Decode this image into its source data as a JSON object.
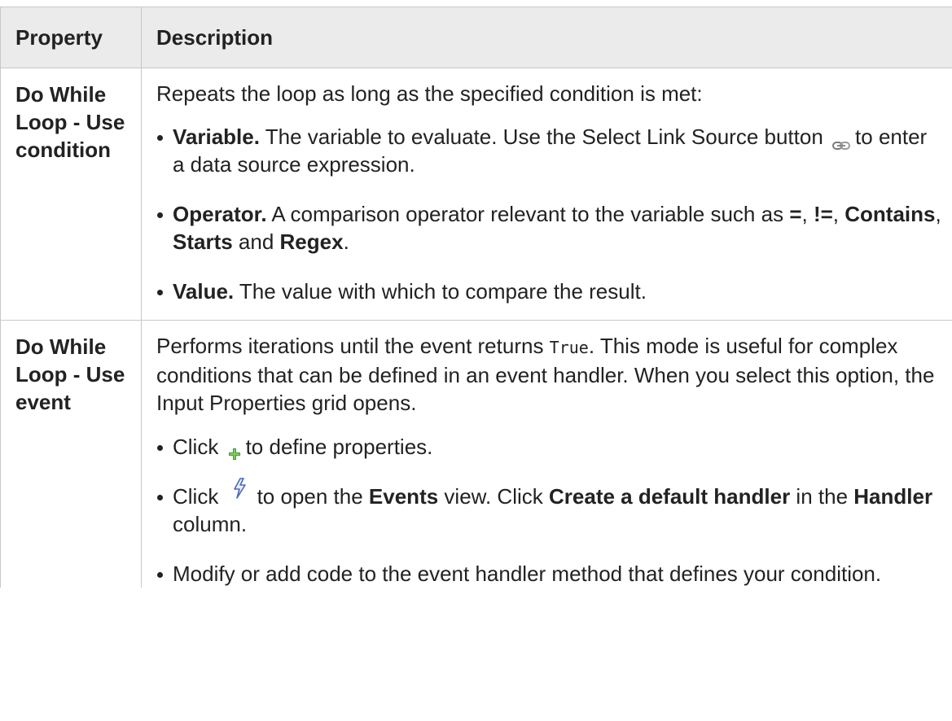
{
  "table": {
    "headers": {
      "property": "Property",
      "description": "Description"
    },
    "row1": {
      "property": "Do While Loop - Use condition",
      "intro": "Repeats the loop as long as the specified condition is met:",
      "variable": {
        "term": "Variable.",
        "text_before_icon": " The variable to evaluate. Use the Select Link Source button",
        "text_after_icon": "to enter a data source expression."
      },
      "operator": {
        "term": "Operator.",
        "text1": " A comparison operator relevant to the variable such as",
        "op_eq": "=",
        "sep1": ", ",
        "op_neq": "!=",
        "sep2": ", ",
        "op_contains": "Contains",
        "sep3": ", ",
        "op_starts": "Starts",
        "sep4": " and ",
        "op_regex": "Regex",
        "end": "."
      },
      "value": {
        "term": "Value.",
        "text": " The value with which to compare the result."
      }
    },
    "row2": {
      "property": "Do While Loop - Use event",
      "intro_before_code": "Performs iterations until the event returns ",
      "code": "True",
      "intro_after_code": ". This mode is useful for complex conditions that can be defined in an event handler. When you select this option, the Input Properties grid opens.",
      "step1": {
        "click": "Click",
        "text": "to define properties."
      },
      "step2": {
        "click": "Click",
        "text1": "to open the ",
        "events": "Events",
        "text2": " view. Click ",
        "create": "Create a default handler",
        "text3": " in the ",
        "handler": "Handler",
        "text4": " column."
      },
      "step3": {
        "text": "Modify or add code to the event handler method that defines your condition."
      }
    }
  },
  "icons": {
    "select_link_source": "link-icon",
    "add_property": "plus-icon",
    "events": "lightning-icon"
  },
  "colors": {
    "header_bg": "#ebebeb",
    "border": "#c8c8c8",
    "text": "#222222",
    "plus_green": "#3f9a2c",
    "lightning_blue": "#4a68b4"
  }
}
